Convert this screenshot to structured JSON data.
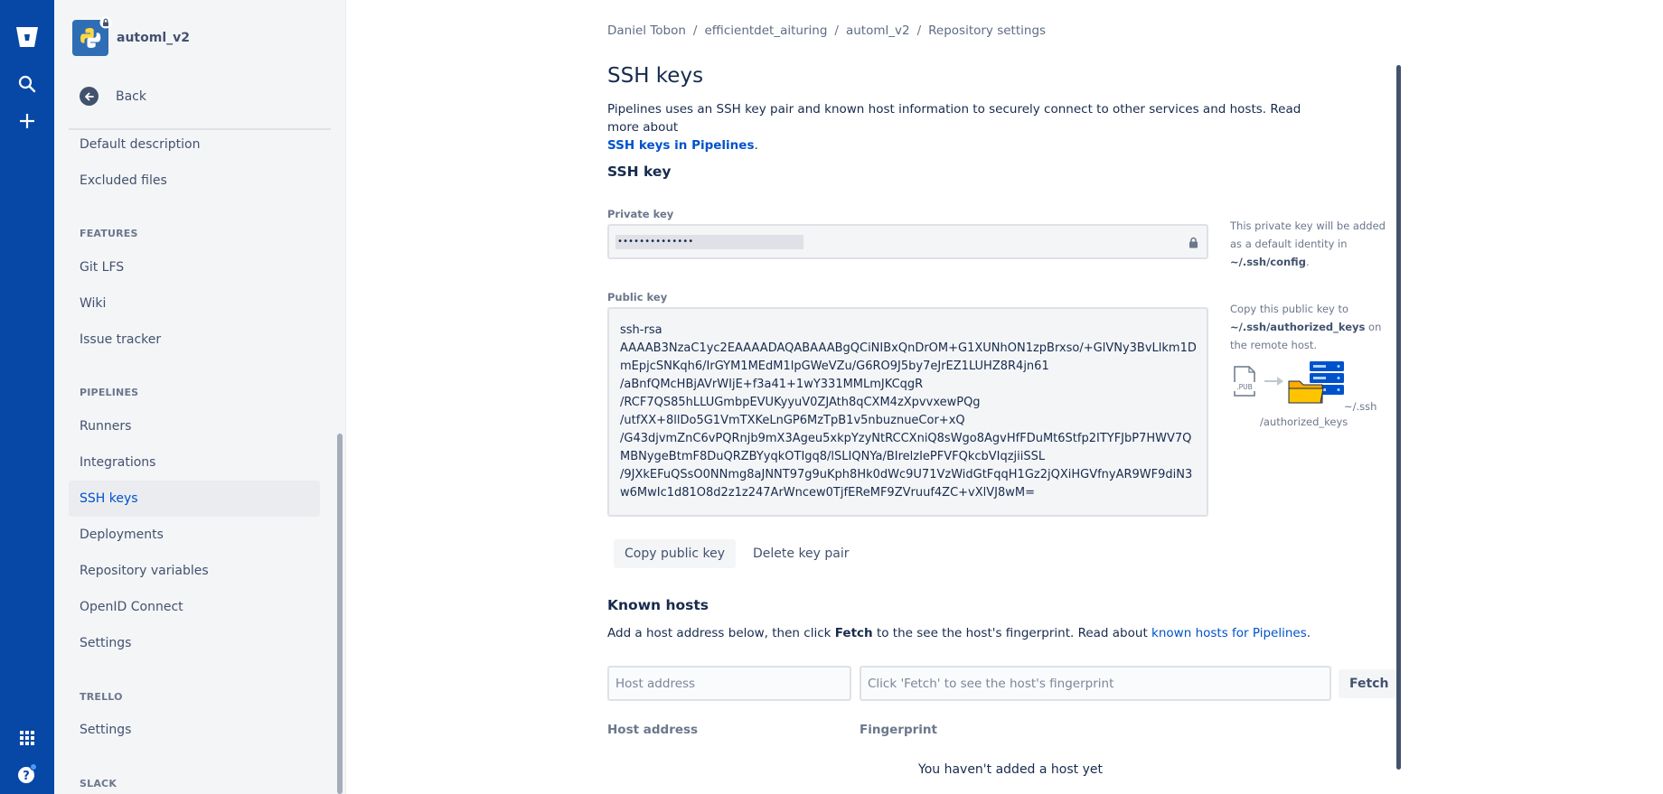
{
  "global_nav": {
    "icons": [
      "bitbucket-logo-icon",
      "search-icon",
      "create-icon",
      "app-switcher-icon",
      "help-icon"
    ]
  },
  "sidebar": {
    "repo_name": "automl_v2",
    "back_label": "Back",
    "top_items": [
      {
        "label": "Default description"
      },
      {
        "label": "Excluded files"
      }
    ],
    "sections": [
      {
        "heading": "FEATURES",
        "items": [
          "Git LFS",
          "Wiki",
          "Issue tracker"
        ]
      },
      {
        "heading": "PIPELINES",
        "items": [
          "Runners",
          "Integrations",
          "SSH keys",
          "Deployments",
          "Repository variables",
          "OpenID Connect",
          "Settings"
        ]
      },
      {
        "heading": "TRELLO",
        "items": [
          "Settings"
        ]
      },
      {
        "heading": "SLACK",
        "items": []
      }
    ],
    "active_item": "SSH keys"
  },
  "breadcrumb": [
    "Daniel Tobon",
    "efficientdet_aituring",
    "automl_v2",
    "Repository settings"
  ],
  "page_title": "SSH keys",
  "intro": {
    "text": "Pipelines uses an SSH key pair and known host information to securely connect to other services and hosts. Read more about",
    "link": "SSH keys in Pipelines",
    "suffix": "."
  },
  "ssh_key": {
    "heading": "SSH key",
    "private_label": "Private key",
    "private_masked": "••••••••••••••",
    "private_help_pre": "This private key will be added as a default identity in",
    "private_help_path": "~/.ssh/config",
    "private_help_post": ".",
    "public_label": "Public key",
    "public_key_lines": [
      "ssh-rsa",
      "AAAAB3NzaC1yc2EAAAADAQABAAABgQCiNIBxQnDrOM+G1XUNhON1zpBrxso/+GlVNy3BvLlkm1D",
      "mEpjcSNKqh6/IrGYM1MEdM1lpGWeVZu/G6RO9J5by7eJrEZ1LUHZ8R4jn61",
      "/aBnfQMcHBjAVrWIjE+f3a41+1wY331MMLmJKCqgR",
      "/RCF7QS85hLLUGmbpEVUKyyuV0ZJAth8qCXM4zXpvvxewPQg",
      "/utfXX+8llDo5G1VmTXKeLnGP6MzTpB1v5nbuznueCor+xQ",
      "/G43djvmZnC6vPQRnjb9mX3Ageu5xkpYzyNtRCCXniQ8sWgo8AgvHfFDuMt6Stfp2ITYFJbP7HWV7Q",
      "MBNygeBtmF8DuQRZBYyqkOTIgq8/lSLIQNYa/BIrelzIePFVFQkcbVIqzjiiSSL",
      "/9JXkEFuQSsO0NNmg8aJNNT97g9uKph8Hk0dWc9U71VzWidGtFqqH1Gz2jQXiHGVfnyAR9WF9diN3",
      "w6MwIc1d81O8d2z1z247ArWncew0TjfEReMF9ZVruuf4ZC+vXlVJ8wM="
    ],
    "public_help_pre": "Copy this public key to",
    "public_help_path": "~/.ssh/authorized_keys",
    "public_help_post": "on the remote host.",
    "illus_file_label": ".PUB",
    "illus_caption_1": "~/.ssh",
    "illus_caption_2": "/authorized_keys",
    "copy_button": "Copy public key",
    "delete_button": "Delete key pair"
  },
  "known_hosts": {
    "heading": "Known hosts",
    "desc_pre": "Add a host address below, then click",
    "desc_bold": "Fetch",
    "desc_mid": "to the see the host's fingerprint. Read about",
    "desc_link": "known hosts for Pipelines",
    "desc_post": ".",
    "host_placeholder": "Host address",
    "fingerprint_placeholder": "Click 'Fetch' to see the host's fingerprint",
    "fetch_button": "Fetch",
    "col_host": "Host address",
    "col_fingerprint": "Fingerprint",
    "empty_text": "You haven't added a host yet"
  },
  "colors": {
    "global_nav": "#0747a6",
    "link": "#0052cc",
    "sidebar_bg": "#f4f5f7",
    "text": "#172b4d"
  }
}
